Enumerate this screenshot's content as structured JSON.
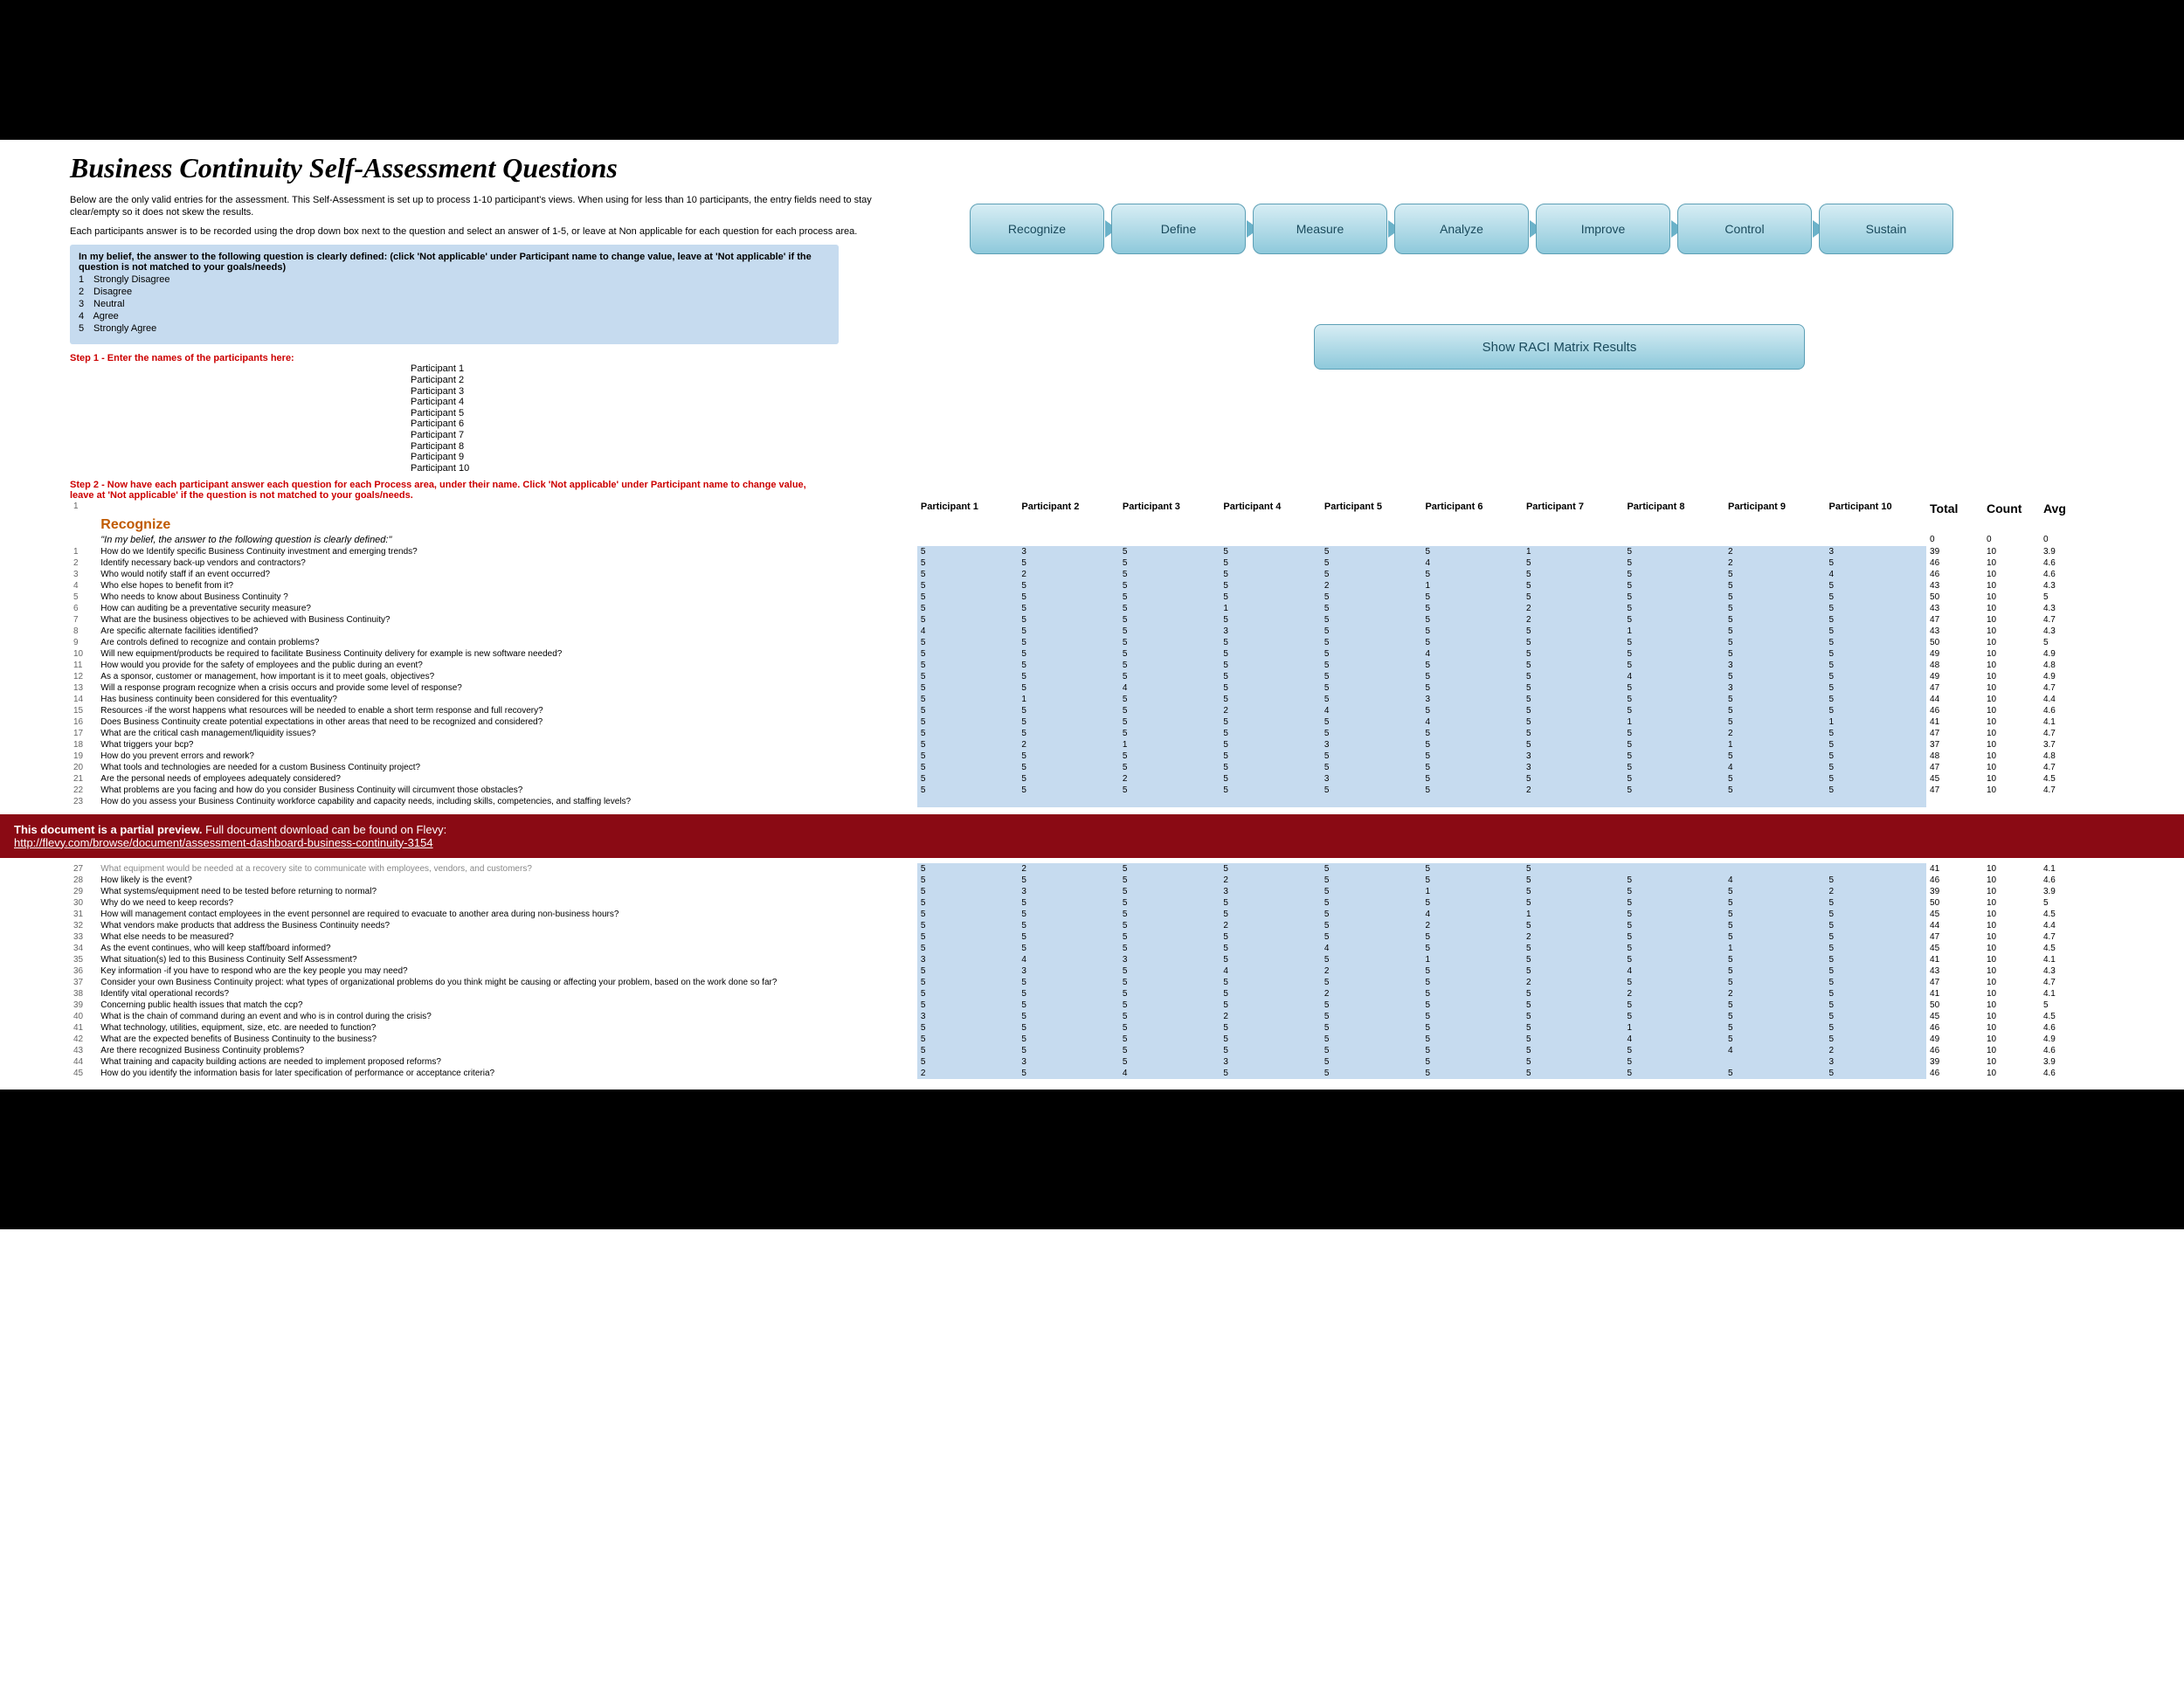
{
  "title": "Business Continuity Self-Assessment Questions",
  "intro1": "Below are the only valid entries for the assessment. This Self-Assessment is set up to process 1-10 participant's views. When using for less than 10 participants, the entry fields need to stay clear/empty so it does not skew the results.",
  "intro2": "Each participants answer is to be recorded using the drop down box next to the question and select an answer of 1-5, or leave at Non applicable for each question for each process area.",
  "belief": "In my belief, the answer to the following question is clearly defined: (click 'Not applicable' under Participant name to change value, leave at 'Not applicable' if the question is not matched to your goals/needs)",
  "scale": [
    {
      "n": "1",
      "l": "Strongly Disagree"
    },
    {
      "n": "2",
      "l": "Disagree"
    },
    {
      "n": "3",
      "l": "Neutral"
    },
    {
      "n": "4",
      "l": "Agree"
    },
    {
      "n": "5",
      "l": "Strongly Agree"
    }
  ],
  "step1": "Step 1 - Enter the names of the participants here:",
  "participants": [
    "Participant 1",
    "Participant 2",
    "Participant 3",
    "Participant 4",
    "Participant 5",
    "Participant 6",
    "Participant 7",
    "Participant 8",
    "Participant 9",
    "Participant 10"
  ],
  "step2": "Step 2 - Now have each participant answer each question for each Process area, under their name. Click 'Not applicable' under Participant name to change value, leave at 'Not applicable' if the question is not matched to your goals/needs.",
  "flow": [
    "Recognize",
    "Define",
    "Measure",
    "Analyze",
    "Improve",
    "Control",
    "Sustain"
  ],
  "raci": "Show RACI Matrix Results",
  "sectionMarker": "1",
  "section": "Recognize",
  "beliefRow": "\"In my belief, the answer to the following question is clearly defined:\"",
  "beliefTotals": {
    "total": "0",
    "count": "0",
    "avg": "0"
  },
  "headers": {
    "total": "Total",
    "count": "Count",
    "avg": "Avg"
  },
  "rows1": [
    {
      "n": "1",
      "q": "How do we Identify specific Business Continuity investment and emerging trends?",
      "v": [
        "5",
        "3",
        "5",
        "5",
        "5",
        "5",
        "1",
        "5",
        "2",
        "3"
      ],
      "t": "39",
      "c": "10",
      "a": "3.9"
    },
    {
      "n": "2",
      "q": "Identify necessary back-up vendors and contractors?",
      "v": [
        "5",
        "5",
        "5",
        "5",
        "5",
        "4",
        "5",
        "5",
        "2",
        "5"
      ],
      "t": "46",
      "c": "10",
      "a": "4.6"
    },
    {
      "n": "3",
      "q": "Who would notify staff if an event occurred?",
      "v": [
        "5",
        "2",
        "5",
        "5",
        "5",
        "5",
        "5",
        "5",
        "5",
        "4"
      ],
      "t": "46",
      "c": "10",
      "a": "4.6"
    },
    {
      "n": "4",
      "q": "Who else hopes to benefit from it?",
      "v": [
        "5",
        "5",
        "5",
        "5",
        "2",
        "1",
        "5",
        "5",
        "5",
        "5"
      ],
      "t": "43",
      "c": "10",
      "a": "4.3"
    },
    {
      "n": "5",
      "q": "Who needs to know about Business Continuity ?",
      "v": [
        "5",
        "5",
        "5",
        "5",
        "5",
        "5",
        "5",
        "5",
        "5",
        "5"
      ],
      "t": "50",
      "c": "10",
      "a": "5"
    },
    {
      "n": "6",
      "q": "How can auditing be a preventative security measure?",
      "v": [
        "5",
        "5",
        "5",
        "1",
        "5",
        "5",
        "2",
        "5",
        "5",
        "5"
      ],
      "t": "43",
      "c": "10",
      "a": "4.3"
    },
    {
      "n": "7",
      "q": "What are the business objectives to be achieved with Business Continuity?",
      "v": [
        "5",
        "5",
        "5",
        "5",
        "5",
        "5",
        "2",
        "5",
        "5",
        "5"
      ],
      "t": "47",
      "c": "10",
      "a": "4.7"
    },
    {
      "n": "8",
      "q": "Are specific alternate facilities identified?",
      "v": [
        "4",
        "5",
        "5",
        "3",
        "5",
        "5",
        "5",
        "1",
        "5",
        "5"
      ],
      "t": "43",
      "c": "10",
      "a": "4.3"
    },
    {
      "n": "9",
      "q": "Are controls defined to recognize and contain problems?",
      "v": [
        "5",
        "5",
        "5",
        "5",
        "5",
        "5",
        "5",
        "5",
        "5",
        "5"
      ],
      "t": "50",
      "c": "10",
      "a": "5"
    },
    {
      "n": "10",
      "q": "Will new equipment/products be required to facilitate Business Continuity delivery for example is new software needed?",
      "v": [
        "5",
        "5",
        "5",
        "5",
        "5",
        "4",
        "5",
        "5",
        "5",
        "5"
      ],
      "t": "49",
      "c": "10",
      "a": "4.9"
    },
    {
      "n": "11",
      "q": "How would you provide for the safety of employees and the public during an event?",
      "v": [
        "5",
        "5",
        "5",
        "5",
        "5",
        "5",
        "5",
        "5",
        "3",
        "5"
      ],
      "t": "48",
      "c": "10",
      "a": "4.8"
    },
    {
      "n": "12",
      "q": "As a sponsor, customer or management, how important is it to meet goals, objectives?",
      "v": [
        "5",
        "5",
        "5",
        "5",
        "5",
        "5",
        "5",
        "4",
        "5",
        "5"
      ],
      "t": "49",
      "c": "10",
      "a": "4.9"
    },
    {
      "n": "13",
      "q": "Will a response program recognize when a crisis occurs and provide some level of response?",
      "v": [
        "5",
        "5",
        "4",
        "5",
        "5",
        "5",
        "5",
        "5",
        "3",
        "5"
      ],
      "t": "47",
      "c": "10",
      "a": "4.7"
    },
    {
      "n": "14",
      "q": "Has business continuity been considered for this eventuality?",
      "v": [
        "5",
        "1",
        "5",
        "5",
        "5",
        "3",
        "5",
        "5",
        "5",
        "5"
      ],
      "t": "44",
      "c": "10",
      "a": "4.4"
    },
    {
      "n": "15",
      "q": "Resources -if the worst happens what resources will be needed to enable a short term response and full recovery?",
      "v": [
        "5",
        "5",
        "5",
        "2",
        "4",
        "5",
        "5",
        "5",
        "5",
        "5"
      ],
      "t": "46",
      "c": "10",
      "a": "4.6"
    },
    {
      "n": "16",
      "q": "Does Business Continuity create potential expectations in other areas that need to be recognized and considered?",
      "v": [
        "5",
        "5",
        "5",
        "5",
        "5",
        "4",
        "5",
        "1",
        "5",
        "1"
      ],
      "t": "41",
      "c": "10",
      "a": "4.1"
    },
    {
      "n": "17",
      "q": "What are the critical cash management/liquidity issues?",
      "v": [
        "5",
        "5",
        "5",
        "5",
        "5",
        "5",
        "5",
        "5",
        "2",
        "5"
      ],
      "t": "47",
      "c": "10",
      "a": "4.7"
    },
    {
      "n": "18",
      "q": "What triggers your bcp?",
      "v": [
        "5",
        "2",
        "1",
        "5",
        "3",
        "5",
        "5",
        "5",
        "1",
        "5"
      ],
      "t": "37",
      "c": "10",
      "a": "3.7"
    },
    {
      "n": "19",
      "q": "How do you prevent errors and rework?",
      "v": [
        "5",
        "5",
        "5",
        "5",
        "5",
        "5",
        "3",
        "5",
        "5",
        "5"
      ],
      "t": "48",
      "c": "10",
      "a": "4.8"
    },
    {
      "n": "20",
      "q": "What tools and technologies are needed for a custom Business Continuity project?",
      "v": [
        "5",
        "5",
        "5",
        "5",
        "5",
        "5",
        "3",
        "5",
        "4",
        "5"
      ],
      "t": "47",
      "c": "10",
      "a": "4.7"
    },
    {
      "n": "21",
      "q": "Are the personal needs of employees adequately considered?",
      "v": [
        "5",
        "5",
        "2",
        "5",
        "3",
        "5",
        "5",
        "5",
        "5",
        "5"
      ],
      "t": "45",
      "c": "10",
      "a": "4.5"
    },
    {
      "n": "22",
      "q": "What problems are you facing and how do you consider Business Continuity will circumvent those obstacles?",
      "v": [
        "5",
        "5",
        "5",
        "5",
        "5",
        "5",
        "2",
        "5",
        "5",
        "5"
      ],
      "t": "47",
      "c": "10",
      "a": "4.7"
    },
    {
      "n": "23",
      "q": "How do you assess your Business Continuity workforce capability and capacity needs, including skills, competencies, and staffing levels?",
      "v": [
        "",
        "",
        "",
        "",
        "",
        "",
        "",
        "",
        "",
        ""
      ],
      "t": "",
      "c": "",
      "a": ""
    }
  ],
  "banner": {
    "text": "This document is a partial preview.",
    "text2": "Full document download can be found on Flevy:",
    "url": "http://flevy.com/browse/document/assessment-dashboard-business-continuity-3154"
  },
  "cutRow": {
    "n": "27",
    "q": "What equipment would be needed at a recovery site to communicate with employees, vendors, and customers?",
    "v": [
      "5",
      "2",
      "5",
      "5",
      "5",
      "5",
      "5",
      "",
      "",
      ""
    ],
    "t": "41",
    "c": "10",
    "a": "4.1"
  },
  "rows2": [
    {
      "n": "28",
      "q": "How likely is the event?",
      "v": [
        "5",
        "5",
        "5",
        "2",
        "5",
        "5",
        "5",
        "5",
        "4",
        "5"
      ],
      "t": "46",
      "c": "10",
      "a": "4.6"
    },
    {
      "n": "29",
      "q": "What systems/equipment need to be tested before returning to normal?",
      "v": [
        "5",
        "3",
        "5",
        "3",
        "5",
        "1",
        "5",
        "5",
        "5",
        "2"
      ],
      "t": "39",
      "c": "10",
      "a": "3.9"
    },
    {
      "n": "30",
      "q": "Why do we need to keep records?",
      "v": [
        "5",
        "5",
        "5",
        "5",
        "5",
        "5",
        "5",
        "5",
        "5",
        "5"
      ],
      "t": "50",
      "c": "10",
      "a": "5"
    },
    {
      "n": "31",
      "q": "How will management contact employees in the event personnel are required to evacuate to another area during non-business hours?",
      "v": [
        "5",
        "5",
        "5",
        "5",
        "5",
        "4",
        "1",
        "5",
        "5",
        "5"
      ],
      "t": "45",
      "c": "10",
      "a": "4.5"
    },
    {
      "n": "32",
      "q": "What vendors make products that address the Business Continuity needs?",
      "v": [
        "5",
        "5",
        "5",
        "2",
        "5",
        "2",
        "5",
        "5",
        "5",
        "5"
      ],
      "t": "44",
      "c": "10",
      "a": "4.4"
    },
    {
      "n": "33",
      "q": "What else needs to be measured?",
      "v": [
        "5",
        "5",
        "5",
        "5",
        "5",
        "5",
        "2",
        "5",
        "5",
        "5"
      ],
      "t": "47",
      "c": "10",
      "a": "4.7"
    },
    {
      "n": "34",
      "q": "As the event continues, who will keep staff/board informed?",
      "v": [
        "5",
        "5",
        "5",
        "5",
        "4",
        "5",
        "5",
        "5",
        "1",
        "5"
      ],
      "t": "45",
      "c": "10",
      "a": "4.5"
    },
    {
      "n": "35",
      "q": "What situation(s) led to this Business Continuity Self Assessment?",
      "v": [
        "3",
        "4",
        "3",
        "5",
        "5",
        "1",
        "5",
        "5",
        "5",
        "5"
      ],
      "t": "41",
      "c": "10",
      "a": "4.1"
    },
    {
      "n": "36",
      "q": "Key information -if you have to respond who are the key people you may need?",
      "v": [
        "5",
        "3",
        "5",
        "4",
        "2",
        "5",
        "5",
        "4",
        "5",
        "5"
      ],
      "t": "43",
      "c": "10",
      "a": "4.3"
    },
    {
      "n": "37",
      "q": "Consider your own Business Continuity project: what types of organizational problems do you think might be causing or affecting your problem, based on the work done so far?",
      "v": [
        "5",
        "5",
        "5",
        "5",
        "5",
        "5",
        "2",
        "5",
        "5",
        "5"
      ],
      "t": "47",
      "c": "10",
      "a": "4.7"
    },
    {
      "n": "38",
      "q": "Identify vital operational records?",
      "v": [
        "5",
        "5",
        "5",
        "5",
        "2",
        "5",
        "5",
        "2",
        "2",
        "5"
      ],
      "t": "41",
      "c": "10",
      "a": "4.1"
    },
    {
      "n": "39",
      "q": "Concerning public health issues that match the ccp?",
      "v": [
        "5",
        "5",
        "5",
        "5",
        "5",
        "5",
        "5",
        "5",
        "5",
        "5"
      ],
      "t": "50",
      "c": "10",
      "a": "5"
    },
    {
      "n": "40",
      "q": "What is the chain of command during an event and who is in control during the crisis?",
      "v": [
        "3",
        "5",
        "5",
        "2",
        "5",
        "5",
        "5",
        "5",
        "5",
        "5"
      ],
      "t": "45",
      "c": "10",
      "a": "4.5"
    },
    {
      "n": "41",
      "q": "What technology, utilities, equipment, size, etc. are needed to function?",
      "v": [
        "5",
        "5",
        "5",
        "5",
        "5",
        "5",
        "5",
        "1",
        "5",
        "5"
      ],
      "t": "46",
      "c": "10",
      "a": "4.6"
    },
    {
      "n": "42",
      "q": "What are the expected benefits of Business Continuity to the business?",
      "v": [
        "5",
        "5",
        "5",
        "5",
        "5",
        "5",
        "5",
        "4",
        "5",
        "5"
      ],
      "t": "49",
      "c": "10",
      "a": "4.9"
    },
    {
      "n": "43",
      "q": "Are there recognized Business Continuity problems?",
      "v": [
        "5",
        "5",
        "5",
        "5",
        "5",
        "5",
        "5",
        "5",
        "4",
        "2"
      ],
      "t": "46",
      "c": "10",
      "a": "4.6"
    },
    {
      "n": "44",
      "q": "What training and capacity building actions are needed to implement proposed reforms?",
      "v": [
        "5",
        "3",
        "5",
        "3",
        "5",
        "5",
        "5",
        "5",
        "",
        "3"
      ],
      "t": "39",
      "c": "10",
      "a": "3.9"
    },
    {
      "n": "45",
      "q": "How do you identify the information basis for later specification of performance or acceptance criteria?",
      "v": [
        "2",
        "5",
        "4",
        "5",
        "5",
        "5",
        "5",
        "5",
        "5",
        "5"
      ],
      "t": "46",
      "c": "10",
      "a": "4.6"
    }
  ]
}
